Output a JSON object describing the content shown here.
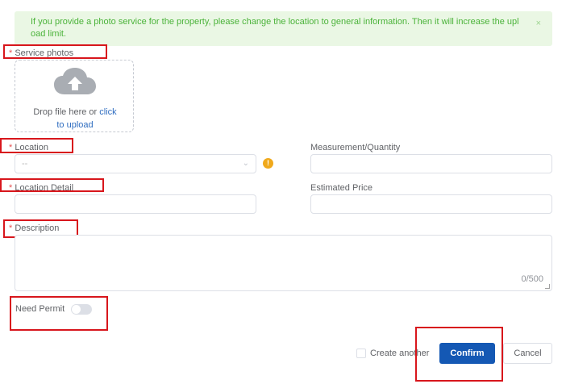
{
  "alert": {
    "line1": "If you provide a photo service for the property, please change the location to general information. Then it will increase the upl",
    "line2": "oad limit.",
    "close_icon": "×"
  },
  "form": {
    "required_mark": "*",
    "service_photos_label": "Service photos",
    "upload": {
      "text": "Drop file here or ",
      "link": "click",
      "link2": "to upload"
    },
    "location_label": "Location",
    "location_value": "--",
    "location_warning": "!",
    "location_detail_label": "Location Detail",
    "measurement_label": "Measurement/Quantity",
    "estimated_price_label": "Estimated Price",
    "description_label": "Description",
    "description_counter": "0/500",
    "need_permit_label": "Need Permit",
    "need_permit_on": false
  },
  "footer": {
    "create_another_label": "Create another",
    "confirm_label": "Confirm",
    "cancel_label": "Cancel"
  },
  "icons": {
    "upload": "cloud-upload-icon",
    "chevron": "chevron-down-icon",
    "warning": "warning-icon",
    "close": "close-icon"
  },
  "colors": {
    "primary": "#1458b4",
    "alert_bg": "#eaf7e4",
    "alert_text": "#4bb33a",
    "required": "#e55353",
    "warning": "#f0a91c",
    "highlight": "#d8161c"
  }
}
